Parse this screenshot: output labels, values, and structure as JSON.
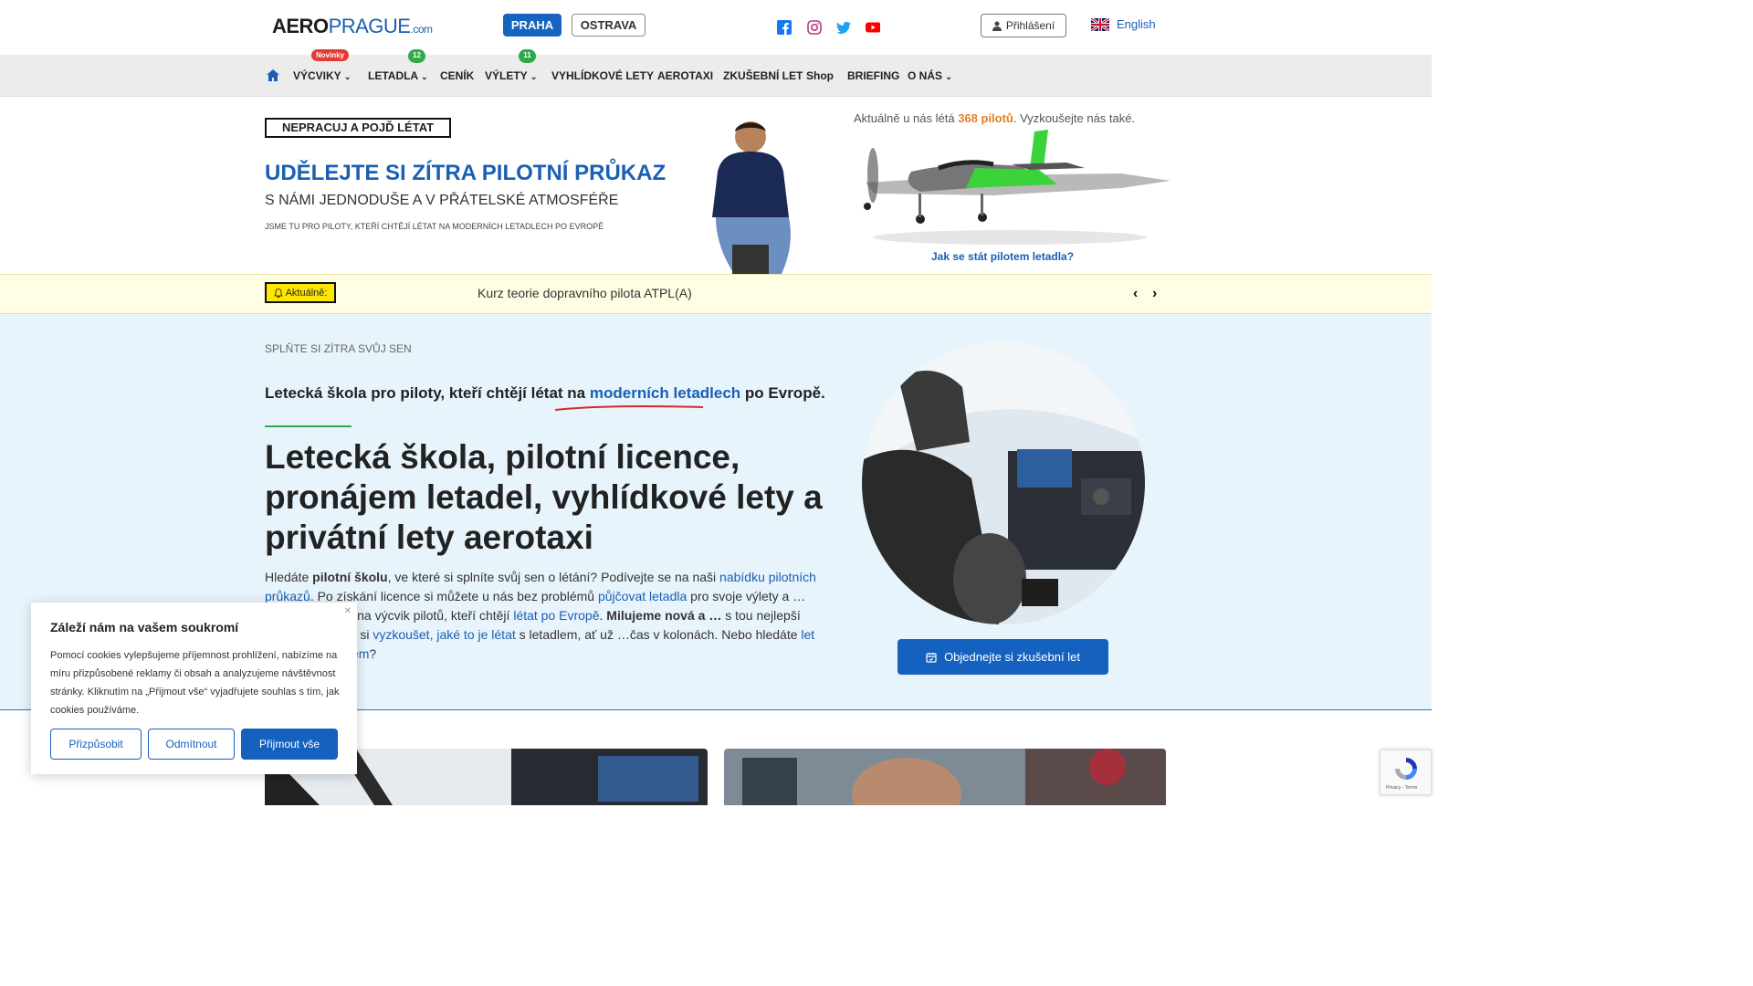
{
  "header": {
    "logo_a": "AERO",
    "logo_b": "PRAGUE",
    "logo_c": ".com",
    "cities": [
      "PRAHA",
      "OSTRAVA"
    ],
    "social_icons": [
      "facebook-icon",
      "instagram-icon",
      "twitter-icon",
      "youtube-icon"
    ],
    "login_label": "Přihlášení",
    "language_label": "English"
  },
  "nav": {
    "items": [
      {
        "label": "VÝCVIKY",
        "badge": "Novinky"
      },
      {
        "label": "LETADLA",
        "badge": "12"
      },
      {
        "label": "CENÍK"
      },
      {
        "label": "VÝLETY",
        "badge": "11"
      },
      {
        "label": "VYHLÍDKOVÉ LETY"
      },
      {
        "label": "AEROTAXI"
      },
      {
        "label": "ZKUŠEBNÍ LET"
      },
      {
        "label": "Shop"
      },
      {
        "label": "BRIEFING"
      },
      {
        "label": "O NÁS"
      }
    ]
  },
  "hero": {
    "slogan": "NEPRACUJ A POJĎ LÉTAT",
    "line1": "UDĚLEJTE SI ZÍTRA PILOTNÍ PRŮKAZ",
    "line2": "S NÁMI JEDNODUŠE A V PŘÁTELSKÉ ATMOSFÉŘE",
    "line3": "JSME TU PRO PILOTY, KTEŘÍ CHTĚJÍ LÉTAT NA MODERNÍCH LETADLECH PO EVROPĚ",
    "pilots_pre": "Aktuálně u nás létá ",
    "pilots_count": "368 pilotů",
    "pilots_post": ". Vyzkoušejte nás také.",
    "how_link": "Jak se stát pilotem letadla?"
  },
  "ticker": {
    "label": "Aktuálně:",
    "text": "Kurz teorie dopravního pilota ATPL(A)"
  },
  "main": {
    "kicker": "SPLŇTE SI ZÍTRA SVŮJ SEN",
    "subhead_pre": "Letecká škola pro piloty, kteří chtějí létat na ",
    "subhead_link": "moderních letadlech",
    "subhead_post": " po Evropě.",
    "title": "Letecká škola, pilotní licence, pronájem letadel, vyhlídkové lety a privátní lety aerotaxi",
    "intro": [
      {
        "t": "Hledáte "
      },
      {
        "t": "pilotní školu",
        "b": true
      },
      {
        "t": ", ve které si splníte svůj sen o létání? Podívejte se na naši "
      },
      {
        "t": "nabídku pilotních průkazů",
        "l": true
      },
      {
        "t": ". Po získání licence si můžete u nás bez problémů "
      },
      {
        "t": "půjčovat letadla",
        "l": true
      },
      {
        "t": " pro svoje výlety a "
      },
      {
        "t": "…"
      },
      {
        "t": " Zaměřujeme se na výcvik pilotů, kteří chtějí "
      },
      {
        "t": "létat po Evropě",
        "l": true
      },
      {
        "t": ". "
      },
      {
        "t": "Milujeme nová a",
        "b": true
      },
      {
        "t": " "
      },
      {
        "t": "…",
        "b": true
      },
      {
        "t": " s tou nejlepší výbavou. Přijďte si "
      },
      {
        "t": "vyzkoušet, jaké to je létat",
        "l": true
      },
      {
        "t": " s letadlem, ať už "
      },
      {
        "t": "…"
      },
      {
        "t": "čas v kolonách. Nebo hledáte "
      },
      {
        "t": "let privátním letadlem",
        "l": true
      },
      {
        "t": "?"
      }
    ],
    "cta": "Objednejte si zkušební let"
  },
  "cookie": {
    "title": "Záleží nám na vašem soukromí",
    "text": "Pomocí cookies vylepšujeme příjemnost prohlížení, nabízíme na míru přizpůsobené reklamy či obsah a analyzujeme návštěvnost stránky. Kliknutím na „Přijmout vše“ vyjadřujete souhlas s tím, jak cookies používáme.",
    "btn_customize": "Přizpůsobit",
    "btn_reject": "Odmítnout",
    "btn_accept": "Přijmout vše"
  },
  "recaptcha": {
    "links": "Privacy - Terms"
  },
  "colors": {
    "brand_blue": "#1561c0",
    "accent_green": "#2eaa4a",
    "badge_red": "#e53935",
    "ticker_yellow": "#ffe600"
  }
}
